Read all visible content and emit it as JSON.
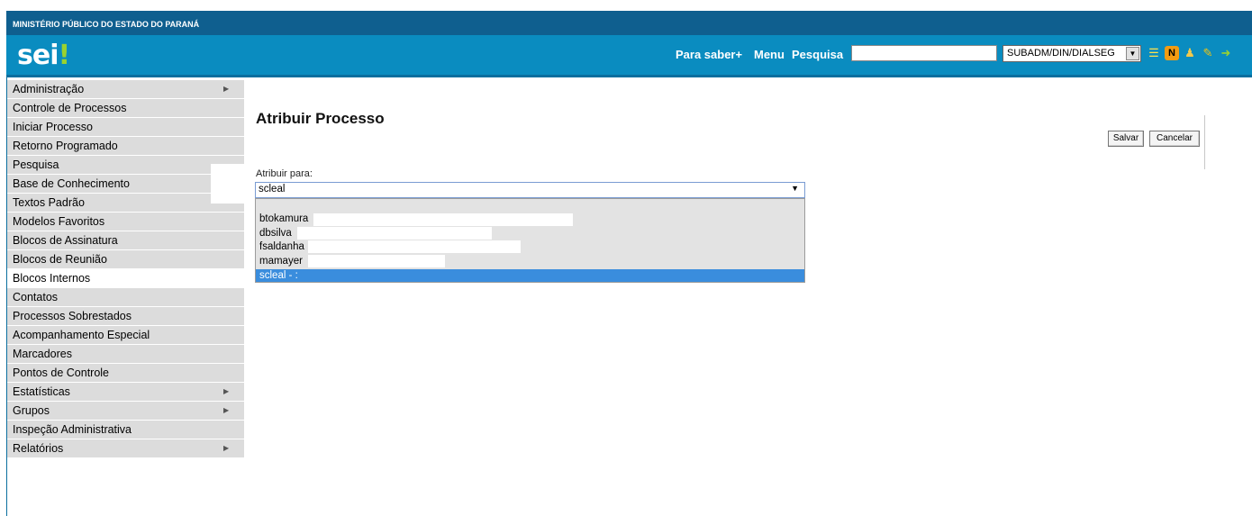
{
  "header": {
    "org_name": "MINISTÉRIO PÚBLICO DO ESTADO DO PARANÁ",
    "logo_text": "sei",
    "logo_mark": "!",
    "links": {
      "para_saber": "Para saber+",
      "menu": "Menu",
      "pesquisa": "Pesquisa"
    },
    "search_value": "",
    "unit_selected": "SUBADM/DIN/DIALSEG",
    "icons": [
      "list-icon",
      "notes-icon",
      "user-icon",
      "tools-icon",
      "exit-icon"
    ],
    "colors": {
      "top_bar": "#0f5f8f",
      "header": "#0a8cc0",
      "logo_mark": "#9ad22f"
    }
  },
  "menu": [
    {
      "label": "Administração",
      "submenu": true
    },
    {
      "label": "Controle de Processos",
      "submenu": false
    },
    {
      "label": "Iniciar Processo",
      "submenu": false
    },
    {
      "label": "Retorno Programado",
      "submenu": false
    },
    {
      "label": "Pesquisa",
      "submenu": false
    },
    {
      "label": "Base de Conhecimento",
      "submenu": false
    },
    {
      "label": "Textos Padrão",
      "submenu": false
    },
    {
      "label": "Modelos Favoritos",
      "submenu": false
    },
    {
      "label": "Blocos de Assinatura",
      "submenu": false
    },
    {
      "label": "Blocos de Reunião",
      "submenu": false
    },
    {
      "label": "Blocos Internos",
      "submenu": false
    },
    {
      "label": "Contatos",
      "submenu": false
    },
    {
      "label": "Processos Sobrestados",
      "submenu": false
    },
    {
      "label": "Acompanhamento Especial",
      "submenu": false
    },
    {
      "label": "Marcadores",
      "submenu": false
    },
    {
      "label": "Pontos de Controle",
      "submenu": false
    },
    {
      "label": "Estatísticas",
      "submenu": true
    },
    {
      "label": "Grupos",
      "submenu": true
    },
    {
      "label": "Inspeção Administrativa",
      "submenu": false
    },
    {
      "label": "Relatórios",
      "submenu": true
    }
  ],
  "main": {
    "title": "Atribuir Processo",
    "save_label": "Salvar",
    "cancel_label": "Cancelar",
    "assign_label": "Atribuir para:",
    "assign_selected": "scleal",
    "options": [
      "btokamura",
      "dbsilva",
      "fsaldanha",
      "mamayer"
    ],
    "highlighted_option": "scleal - :",
    "highlight_color": "#3a8ddd"
  }
}
